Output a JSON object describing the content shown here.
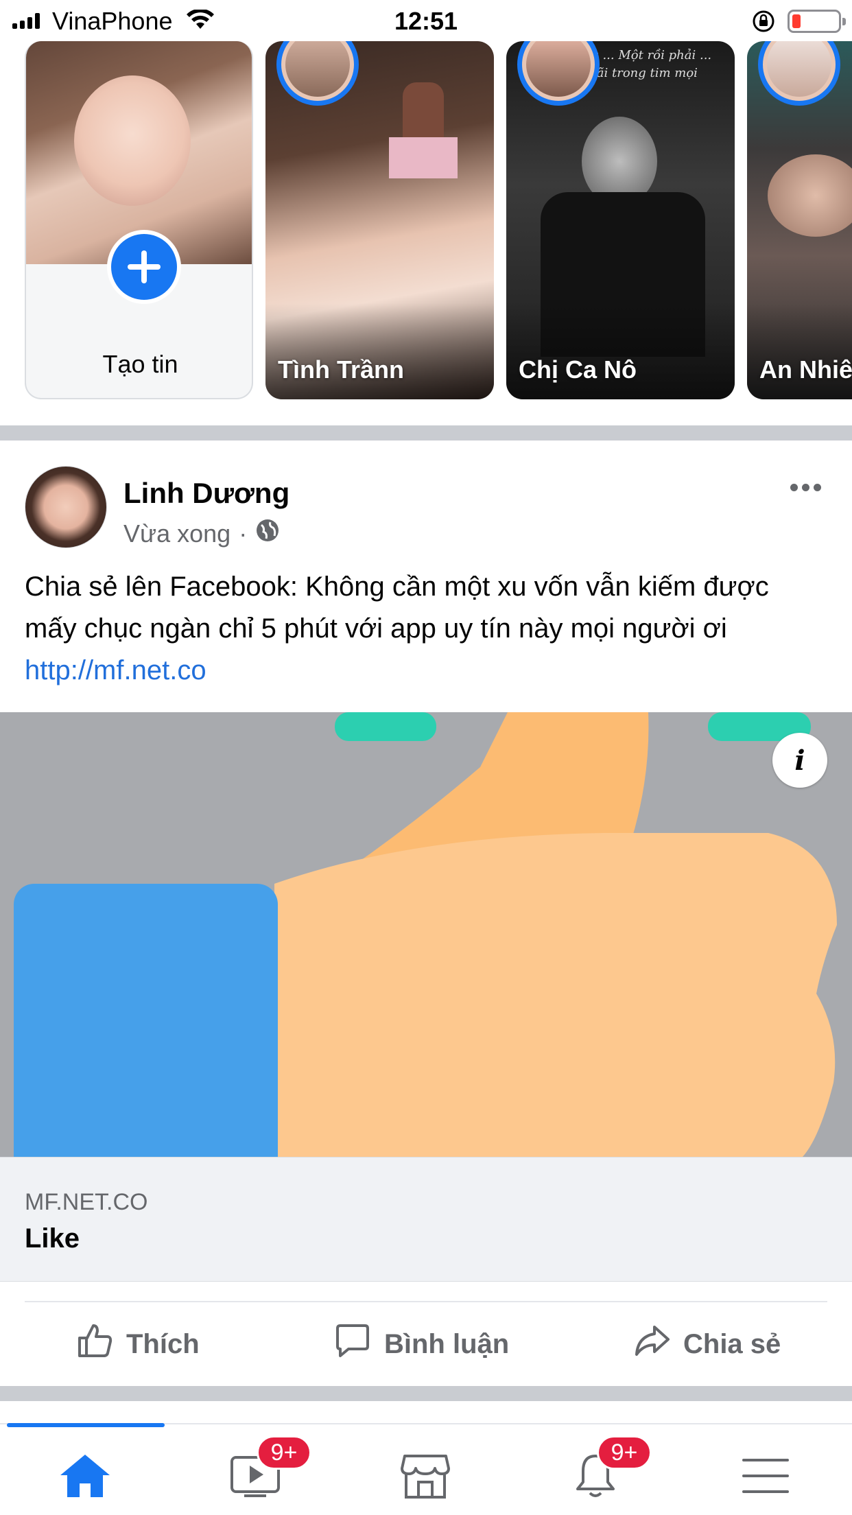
{
  "status_bar": {
    "carrier": "VinaPhone",
    "time": "12:51",
    "battery_color": "#ff3b30"
  },
  "stories": {
    "create_label": "Tạo tin",
    "items": [
      {
        "name": "Tình Trầnn"
      },
      {
        "name": "Chị Ca Nô",
        "caption": "Yêu không ... Một rồi phải ... sẽ sống mãi trong tim mọi người"
      },
      {
        "name": "An Nhiê"
      }
    ]
  },
  "post": {
    "author": "Linh Dương",
    "time": "Vừa xong",
    "privacy_icon": "globe-icon",
    "text": "Chia sẻ lên Facebook: Không cần một xu vốn vẫn kiếm được mấy chục ngàn chỉ 5 phút với app uy tín này mọi người ơi ",
    "link": "http://mf.net.co",
    "preview": {
      "info_label": "i",
      "domain": "MF.NET.CO",
      "title": "Like"
    },
    "actions": {
      "like": "Thích",
      "comment": "Bình luận",
      "share": "Chia sẻ"
    }
  },
  "bottom_nav": {
    "items": [
      {
        "icon": "home-icon",
        "active": true
      },
      {
        "icon": "watch-icon",
        "badge": "9+"
      },
      {
        "icon": "marketplace-icon"
      },
      {
        "icon": "bell-icon",
        "badge": "9+"
      },
      {
        "icon": "menu-icon"
      }
    ]
  },
  "colors": {
    "brand": "#1877f2",
    "link": "#216fdb",
    "badge": "#e41e3f",
    "secondary_text": "#65676b"
  }
}
